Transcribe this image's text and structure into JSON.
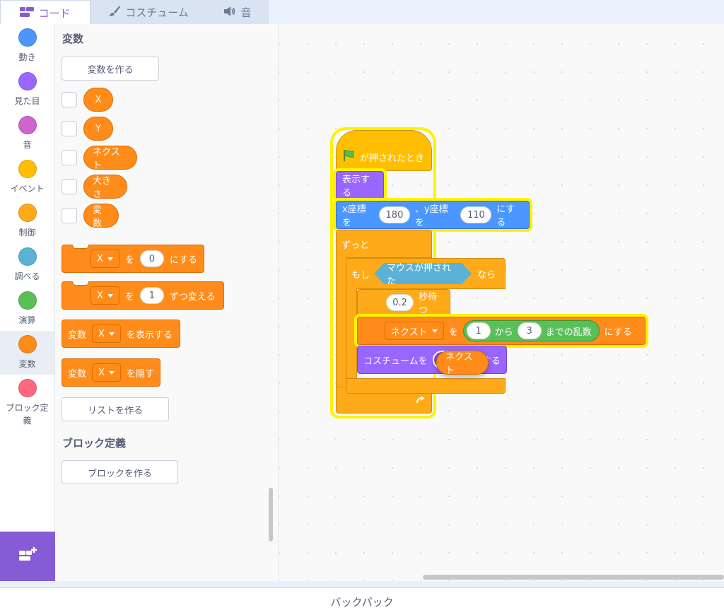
{
  "tabs": [
    {
      "label": "コード",
      "icon": "code-icon"
    },
    {
      "label": "コスチューム",
      "icon": "brush-icon"
    },
    {
      "label": "音",
      "icon": "speaker-icon"
    }
  ],
  "categories": [
    {
      "label": "動き",
      "color": "#4c97ff"
    },
    {
      "label": "見た目",
      "color": "#9966ff"
    },
    {
      "label": "音",
      "color": "#cf63cf"
    },
    {
      "label": "イベント",
      "color": "#ffbf00"
    },
    {
      "label": "制御",
      "color": "#ffab19"
    },
    {
      "label": "調べる",
      "color": "#5cb1d6"
    },
    {
      "label": "演算",
      "color": "#59c059"
    },
    {
      "label": "変数",
      "color": "#ff8c1a"
    },
    {
      "label": "ブロック定義",
      "color": "#ff6680"
    }
  ],
  "palette": {
    "variables_title": "変数",
    "make_variable": "変数を作る",
    "variables": [
      "X",
      "Y",
      "ネクスト",
      "大きさ",
      "変数"
    ],
    "set_block": {
      "var": "X",
      "to": "を",
      "value": "0",
      "suffix": "にする"
    },
    "change_block": {
      "var": "X",
      "by": "を",
      "value": "1",
      "suffix": "ずつ変える"
    },
    "show_block": {
      "prefix": "変数",
      "var": "X",
      "suffix": "を表示する"
    },
    "hide_block": {
      "prefix": "変数",
      "var": "X",
      "suffix": "を隠す"
    },
    "make_list": "リストを作る",
    "myblocks_title": "ブロック定義",
    "make_block": "ブロックを作る"
  },
  "script": {
    "hat": "が押されたとき",
    "show": "表示する",
    "goto": {
      "x_label": "x座標を",
      "x": "180",
      "sep": "、y座標を",
      "y": "110",
      "suffix": "にする"
    },
    "forever": "ずっと",
    "if": {
      "prefix": "もし",
      "condition": "マウスが押された",
      "suffix": "なら"
    },
    "wait": {
      "value": "0.2",
      "suffix": "秒待つ"
    },
    "set_random": {
      "var": "ネクスト",
      "to": "を",
      "from": "1",
      "kara": "から",
      "until": "3",
      "label": "までの乱数",
      "suffix": "にする"
    },
    "switch_costume": {
      "prefix": "コスチュームを",
      "suffix": "にする"
    },
    "dragging_reporter": "ネクスト"
  },
  "backpack": "バックパック"
}
